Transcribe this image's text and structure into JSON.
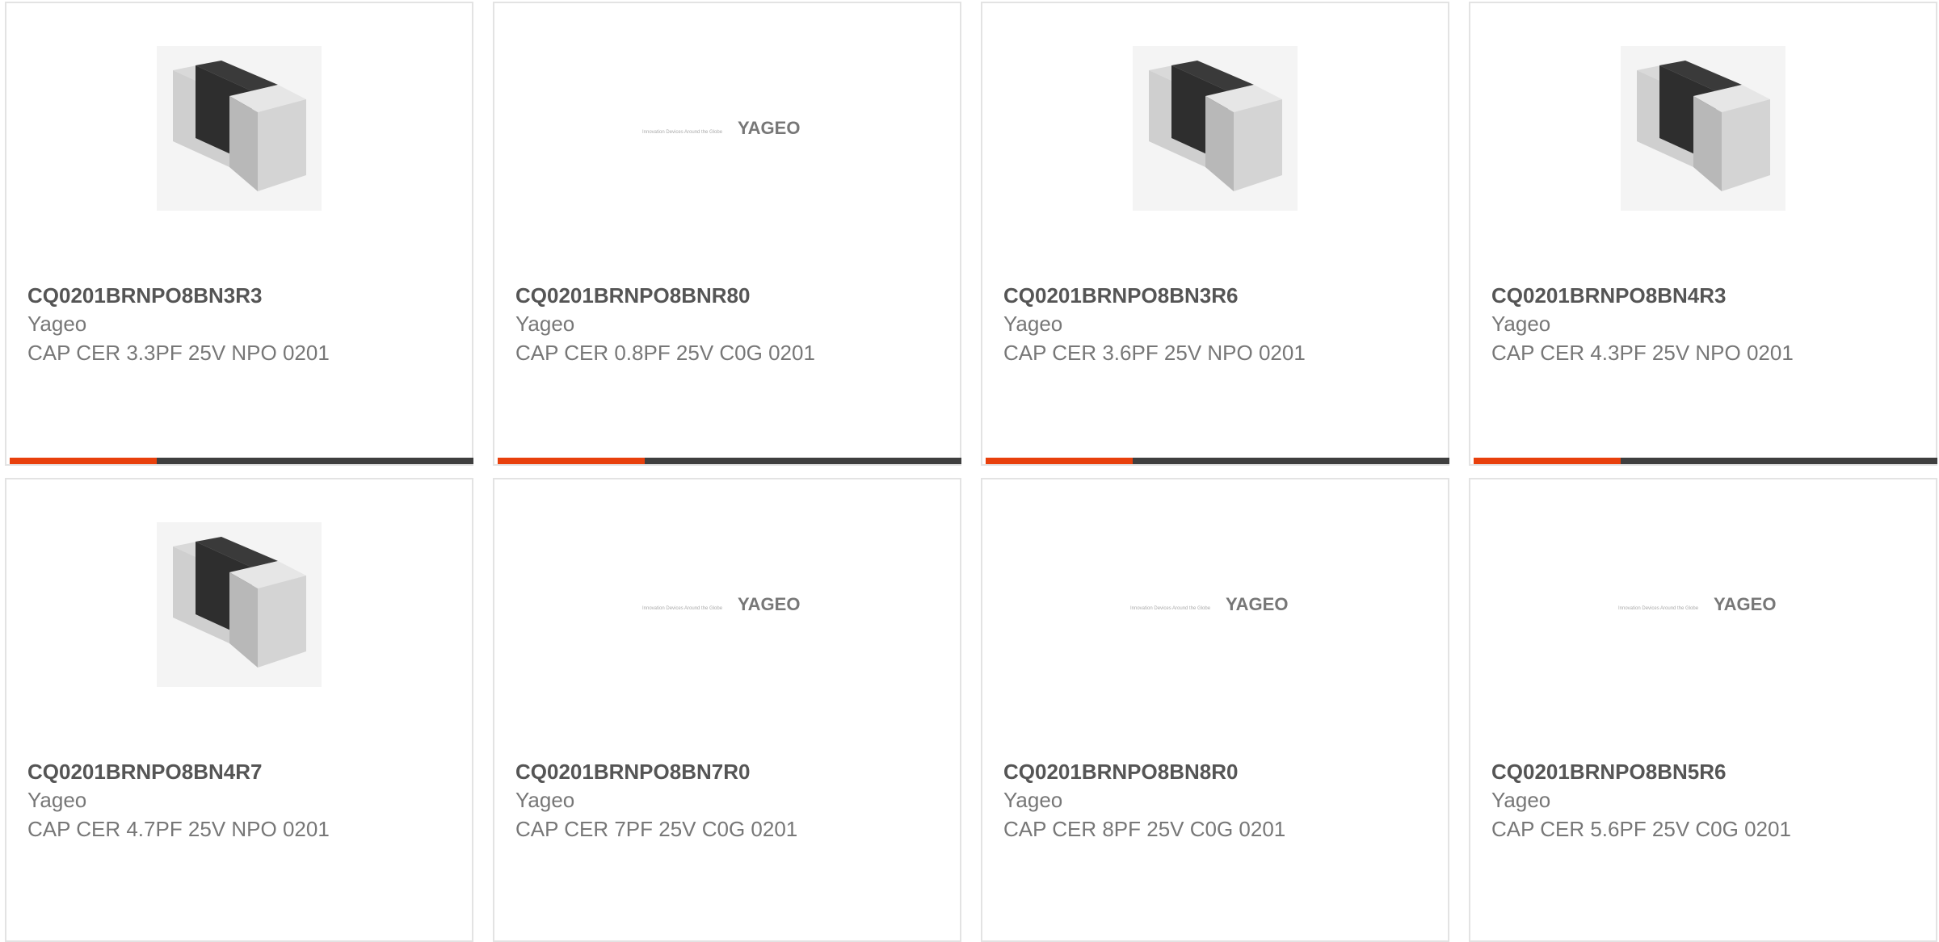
{
  "products": [
    {
      "part_number": "CQ0201BRNPO8BN3R3",
      "manufacturer": "Yageo",
      "description": "CAP CER 3.3PF 25V NPO 0201",
      "image": "chip-capacitor",
      "status_bar": true
    },
    {
      "part_number": "CQ0201BRNPO8BNR80",
      "manufacturer": "Yageo",
      "description": "CAP CER 0.8PF 25V C0G 0201",
      "image": "yageo-logo",
      "status_bar": true
    },
    {
      "part_number": "CQ0201BRNPO8BN3R6",
      "manufacturer": "Yageo",
      "description": "CAP CER 3.6PF 25V NPO 0201",
      "image": "chip-capacitor",
      "status_bar": true
    },
    {
      "part_number": "CQ0201BRNPO8BN4R3",
      "manufacturer": "Yageo",
      "description": "CAP CER 4.3PF 25V NPO 0201",
      "image": "chip-capacitor",
      "status_bar": true
    },
    {
      "part_number": "CQ0201BRNPO8BN4R7",
      "manufacturer": "Yageo",
      "description": "CAP CER 4.7PF 25V NPO 0201",
      "image": "chip-capacitor",
      "status_bar": false
    },
    {
      "part_number": "CQ0201BRNPO8BN7R0",
      "manufacturer": "Yageo",
      "description": "CAP CER 7PF 25V C0G 0201",
      "image": "yageo-logo",
      "status_bar": false
    },
    {
      "part_number": "CQ0201BRNPO8BN8R0",
      "manufacturer": "Yageo",
      "description": "CAP CER 8PF 25V C0G 0201",
      "image": "yageo-logo",
      "status_bar": false
    },
    {
      "part_number": "CQ0201BRNPO8BN5R6",
      "manufacturer": "Yageo",
      "description": "CAP CER 5.6PF 25V C0G 0201",
      "image": "yageo-logo",
      "status_bar": false
    }
  ],
  "logo": {
    "tagline": "Innovation Devices Around the Globe",
    "brand": "YAGEO"
  },
  "colors": {
    "accent": "#e8400c",
    "bar": "#3f3f3f",
    "border": "#e3e3e3",
    "title": "#555555",
    "text": "#777777"
  }
}
